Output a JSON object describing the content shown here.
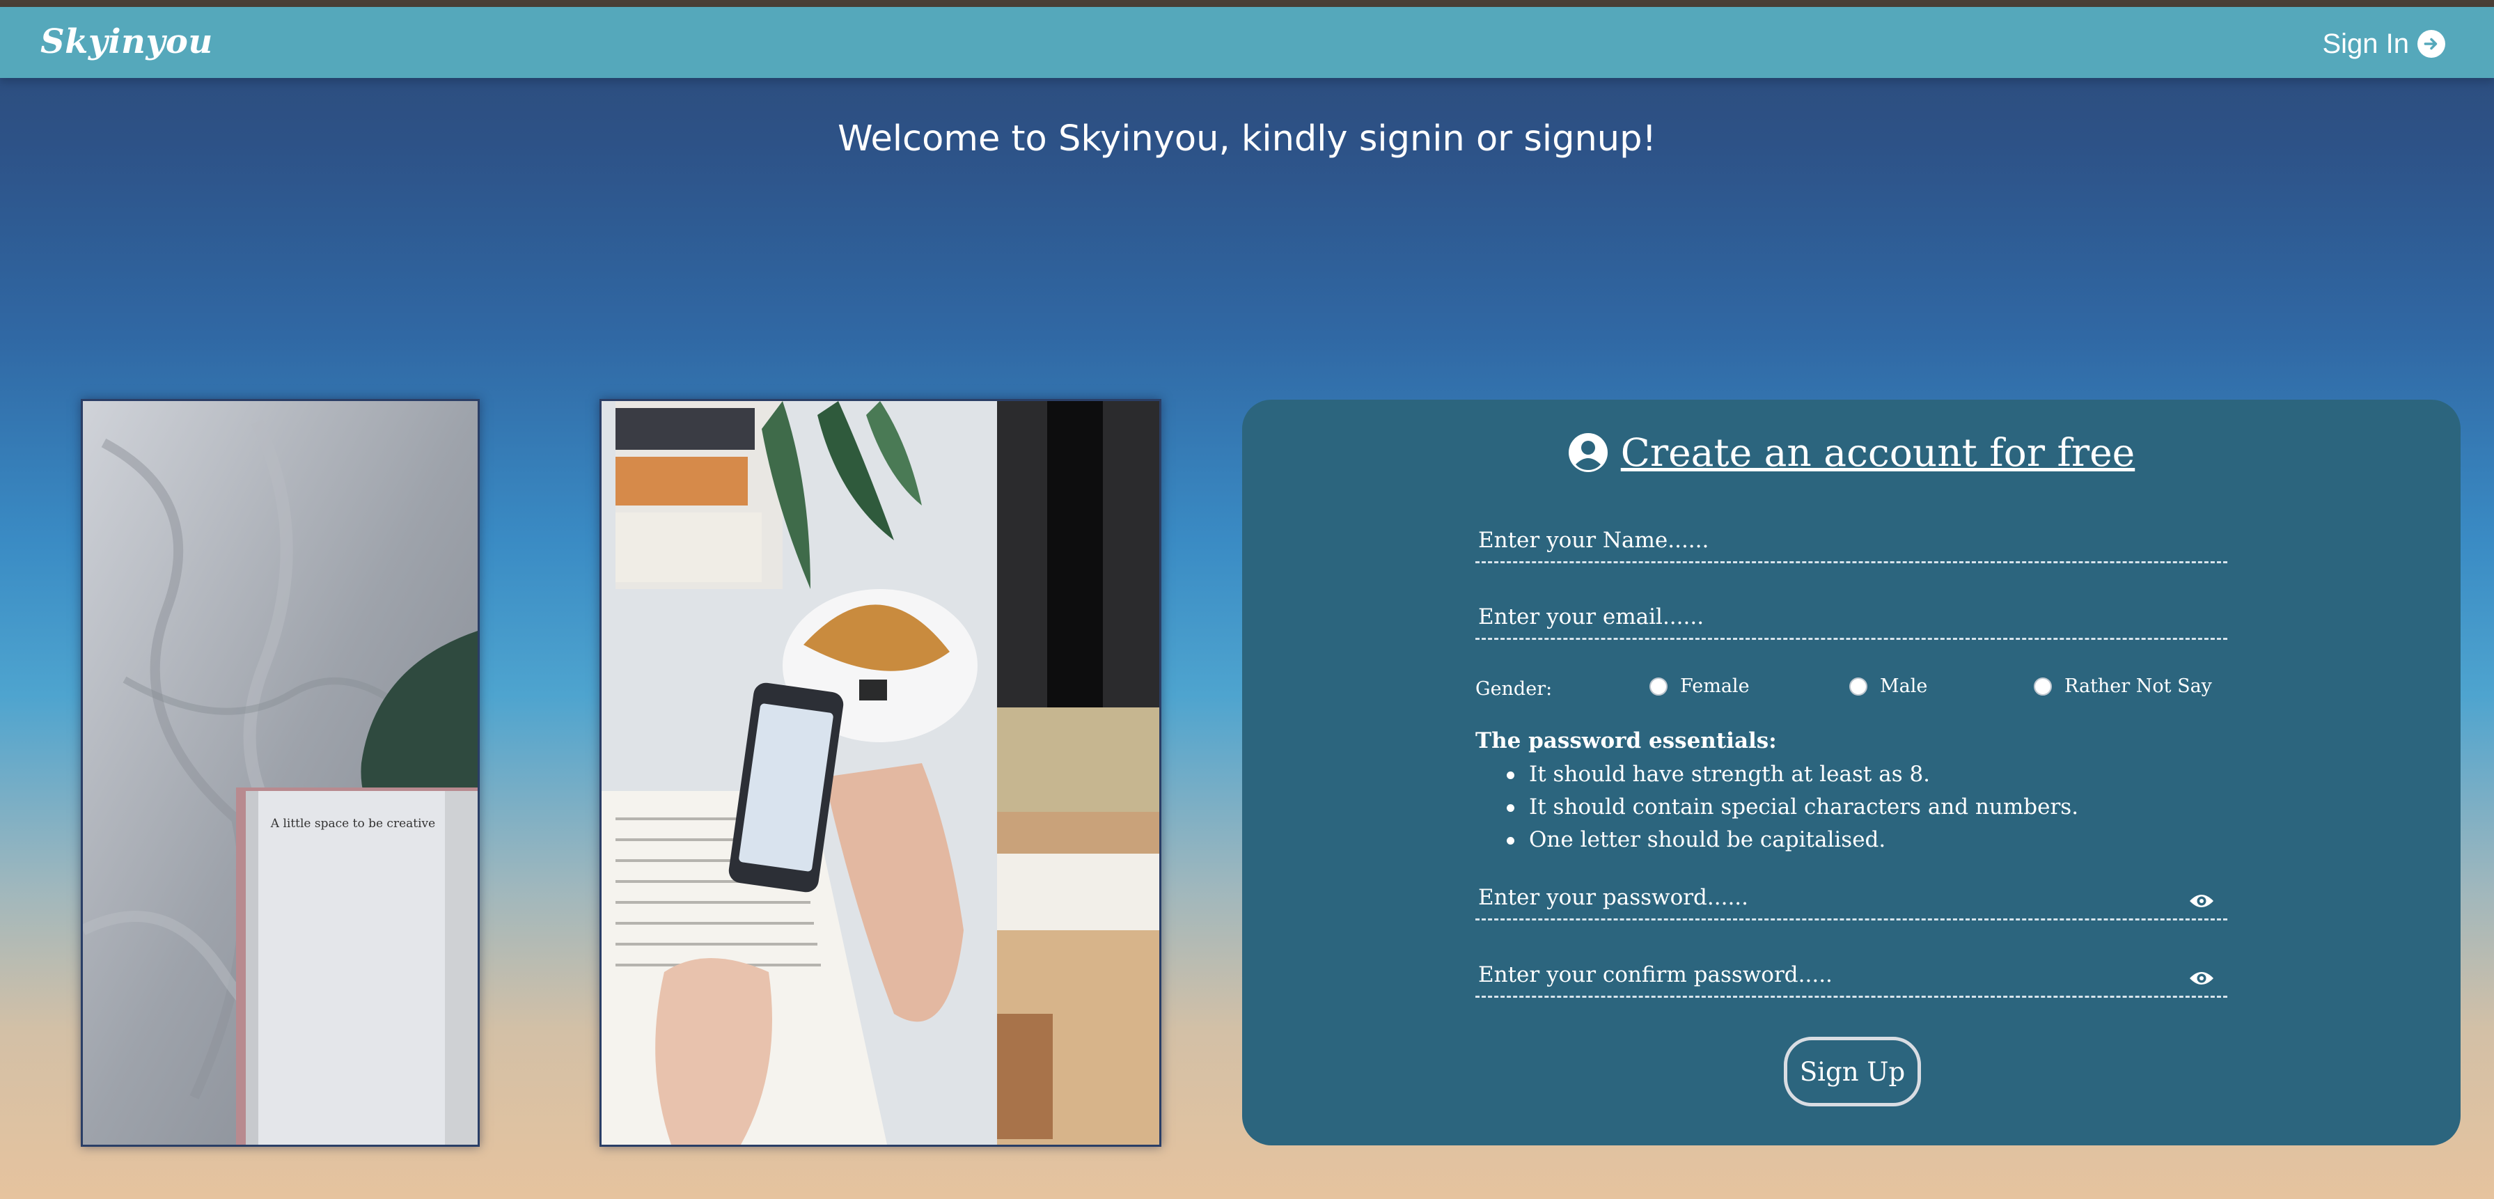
{
  "navbar": {
    "brand": "Skyinyou",
    "signin_label": "Sign In",
    "signin_icon": "arrow-circle-right-icon"
  },
  "welcome_text": "Welcome to Skyinyou, kindly signin or signup!",
  "photos": [
    {
      "description_icon": "bed-book-photo",
      "book_text": "A little space to be creative"
    },
    {
      "description_icon": "phone-book-breakfast-photo"
    }
  ],
  "signup_card": {
    "title": "Create an account for free",
    "title_icon": "user-circle-icon",
    "name_placeholder": "Enter your Name......",
    "email_placeholder": "Enter your email......",
    "gender": {
      "label": "Gender:",
      "options": [
        "Female",
        "Male",
        "Rather Not Say"
      ]
    },
    "password_rules": {
      "title": "The password essentials:",
      "items": [
        "It should have strength at least as 8.",
        "It should contain special characters and numbers.",
        "One letter should be capitalised."
      ]
    },
    "password_placeholder": "Enter your password......",
    "confirm_password_placeholder": "Enter your confirm password.....",
    "password_toggle_icon": "eye-icon",
    "submit_label": "Sign Up"
  },
  "colors": {
    "navbar": "#55a8bb",
    "card": "#2c657e",
    "top_strip": "#4a3f36",
    "text": "#ffffff"
  }
}
